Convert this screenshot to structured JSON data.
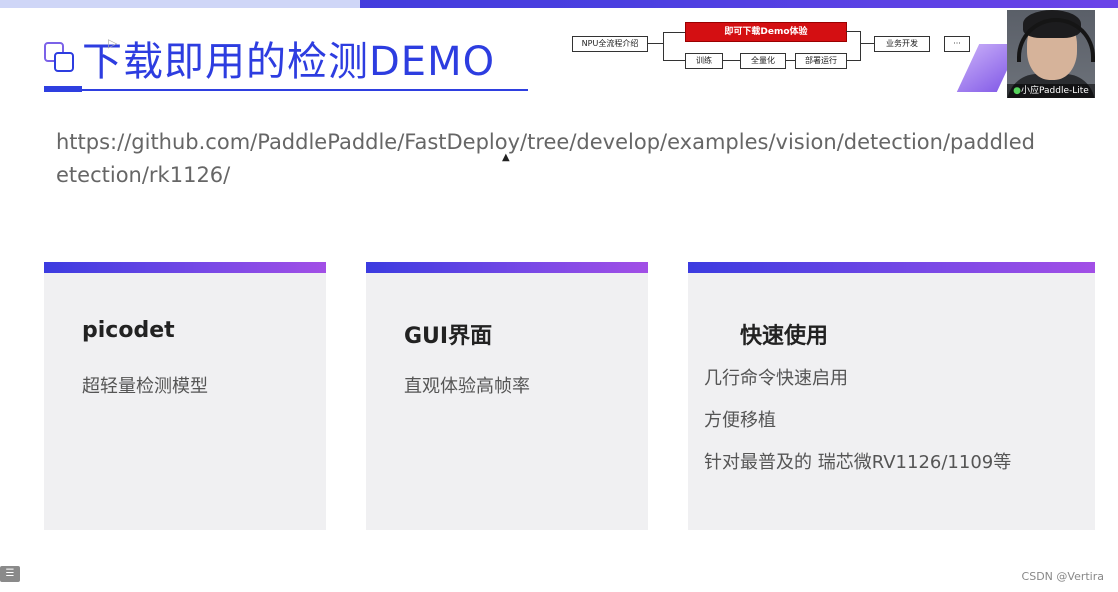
{
  "slide": {
    "title": "下载即用的检测DEMO",
    "url": "https://github.com/PaddlePaddle/FastDeploy/tree/develop/examples/vision/detection/paddledetection/rk1126/"
  },
  "flow": {
    "intro": "NPU全流程介绍",
    "highlight": "即可下载Demo体验",
    "train": "训练",
    "quantize": "全量化",
    "deploy": "部署运行",
    "business": "业务开发",
    "more": "···"
  },
  "cards": [
    {
      "title": "picodet",
      "lines": [
        "超轻量检测模型"
      ]
    },
    {
      "title": "GUI界面",
      "lines": [
        "直观体验高帧率"
      ]
    },
    {
      "title": "快速使用",
      "lines": [
        "几行命令快速启用",
        "方便移植",
        "针对最普及的 瑞芯微RV1126/1109等"
      ]
    }
  ],
  "webcam": {
    "name": "小应Paddle-Lite",
    "mic_icon": "microphone-icon"
  },
  "footer": {
    "menu_icon": "list-icon",
    "watermark": "CSDN @Vertira"
  },
  "colors": {
    "accent": "#2d3de0",
    "gradient_end": "#a24fe6",
    "highlight_red": "#d40f12"
  }
}
